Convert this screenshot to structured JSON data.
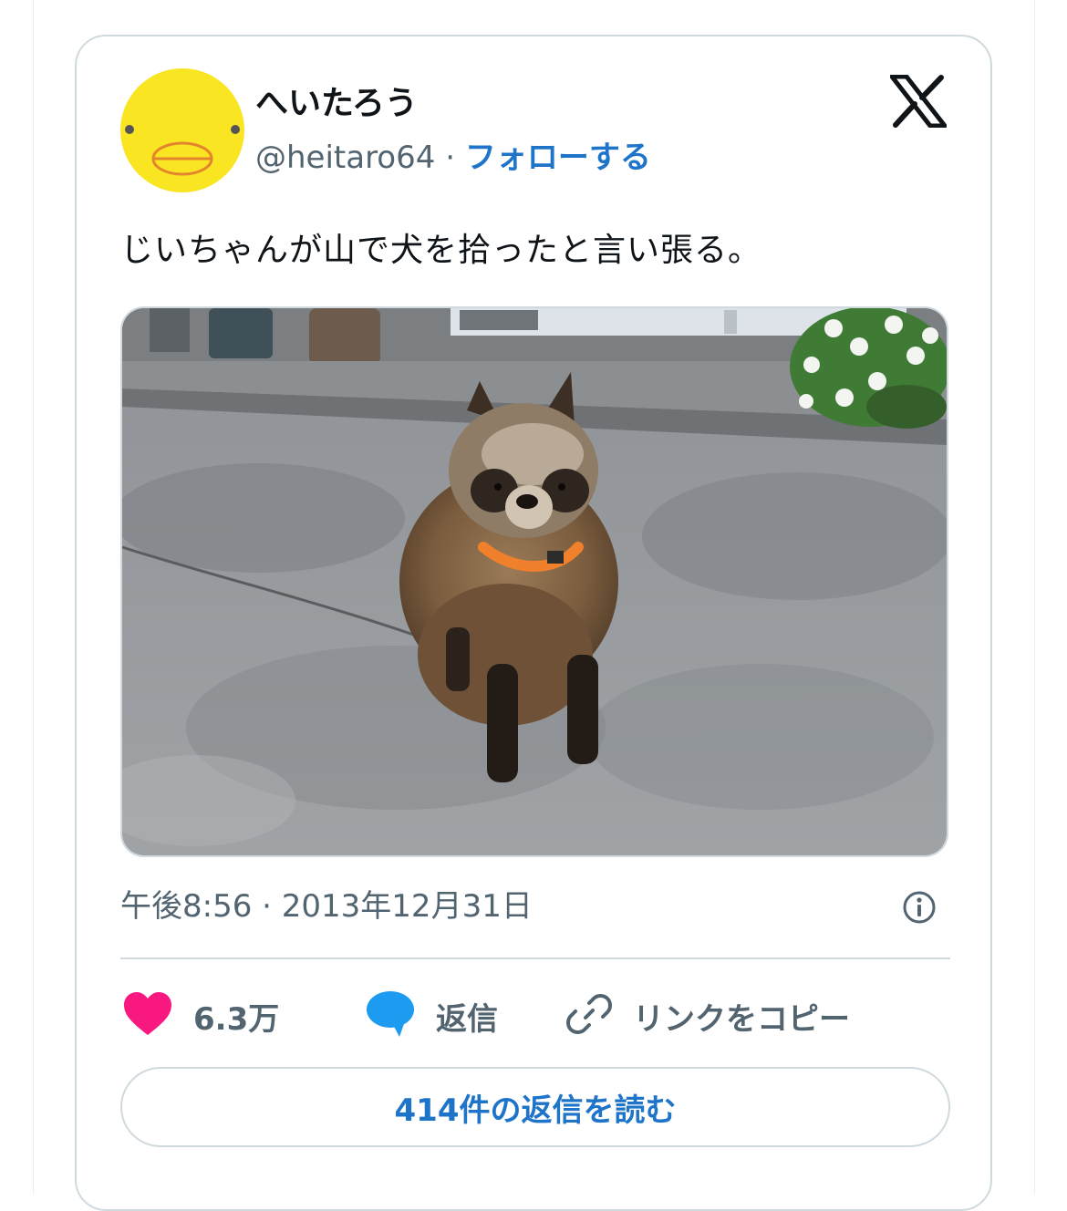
{
  "tweet": {
    "display_name": "へいたろう",
    "handle": "@heitaro64",
    "separator": " · ",
    "follow_label": "フォローする",
    "text": "じいちゃんが山で犬を拾ったと言い張る。",
    "timestamp": "午後8:56 · 2013年12月31日"
  },
  "actions": {
    "like_count": "6.3万",
    "reply_label": "返信",
    "copy_link_label": "リンクをコピー"
  },
  "read_replies_label": "414件の返信を読む",
  "colors": {
    "accent": "#1d74c9",
    "like": "#f91880",
    "reply_bubble": "#1d9bf0",
    "secondary_text": "#536471",
    "border": "#cfd9de",
    "avatar_yellow": "#f9e521"
  },
  "icons": {
    "x": "x-logo-icon",
    "info": "info-icon",
    "like": "heart-icon",
    "reply": "speech-bubble-icon",
    "link": "link-icon"
  }
}
